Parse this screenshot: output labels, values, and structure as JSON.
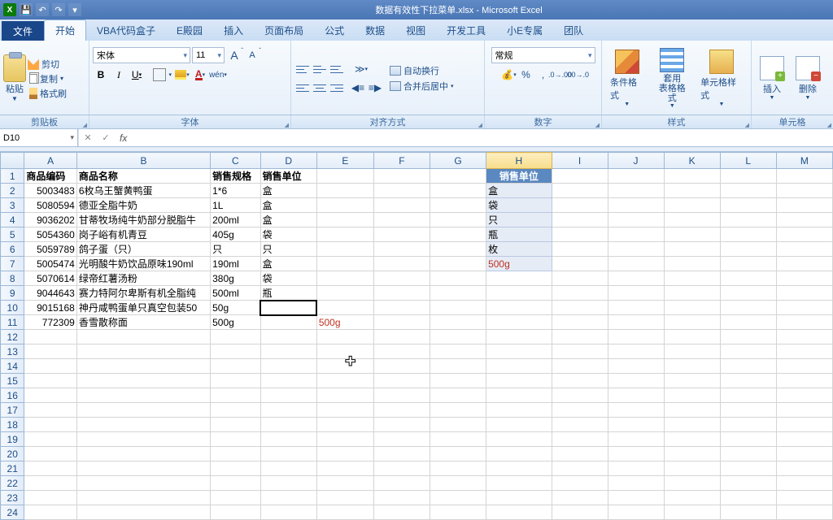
{
  "app": {
    "title": "数据有效性下拉菜单.xlsx - Microsoft Excel"
  },
  "qat": {
    "save": "💾",
    "undo": "↶",
    "redo": "↷"
  },
  "tabs": {
    "file": "文件",
    "items": [
      "开始",
      "VBA代码盒子",
      "E殿园",
      "插入",
      "页面布局",
      "公式",
      "数据",
      "视图",
      "开发工具",
      "小E专属",
      "团队"
    ],
    "active": 0
  },
  "ribbon": {
    "clipboard": {
      "label": "剪贴板",
      "paste": "粘贴",
      "cut": "剪切",
      "copy": "复制",
      "formatPainter": "格式刷"
    },
    "font": {
      "label": "字体",
      "name": "宋体",
      "size": "11"
    },
    "alignment": {
      "label": "对齐方式",
      "wrap": "自动换行",
      "merge": "合并后居中"
    },
    "number": {
      "label": "数字",
      "format": "常规"
    },
    "styles": {
      "label": "样式",
      "cf": "条件格式",
      "table": "套用\n表格格式",
      "cell": "单元格样式"
    },
    "cells": {
      "label": "单元格",
      "insert": "插入",
      "delete": "删除"
    }
  },
  "nameBox": "D10",
  "formulaBar": "",
  "columns": [
    "A",
    "B",
    "C",
    "D",
    "E",
    "F",
    "G",
    "H",
    "I",
    "J",
    "K",
    "L",
    "M"
  ],
  "headers": {
    "A": "商品编码",
    "B": "商品名称",
    "C": "销售规格",
    "D": "销售单位",
    "H": "销售单位"
  },
  "rows": [
    {
      "A": "5003483",
      "B": "6枚乌王蟹黄鸭蛋",
      "C": "1*6",
      "D": "盒"
    },
    {
      "A": "5080594",
      "B": "德亚全脂牛奶",
      "C": "1L",
      "D": "盒"
    },
    {
      "A": "9036202",
      "B": "甘蒂牧场纯牛奶部分脱脂牛",
      "C": "200ml",
      "D": "盒"
    },
    {
      "A": "5054360",
      "B": "岗子峪有机青豆",
      "C": "405g",
      "D": "袋"
    },
    {
      "A": "5059789",
      "B": "鸽子蛋（只）",
      "C": "只",
      "D": "只"
    },
    {
      "A": "5005474",
      "B": "光明酸牛奶饮品原味190ml",
      "C": "190ml",
      "D": "盒"
    },
    {
      "A": "5070614",
      "B": "绿帝红薯汤粉",
      "C": "380g",
      "D": "袋"
    },
    {
      "A": "9044643",
      "B": "赛力特阿尔卑斯有机全脂纯",
      "C": "500ml",
      "D": "瓶"
    },
    {
      "A": "9015168",
      "B": "神丹咸鸭蛋单只真空包装50",
      "C": "50g",
      "D": ""
    },
    {
      "A": "772309",
      "B": "香雪散称面",
      "C": "500g",
      "D": "",
      "E": "500g"
    }
  ],
  "validationList": [
    "盒",
    "袋",
    "只",
    "瓶",
    "枚"
  ],
  "invalidValue": "500g",
  "activeCell": "D10"
}
